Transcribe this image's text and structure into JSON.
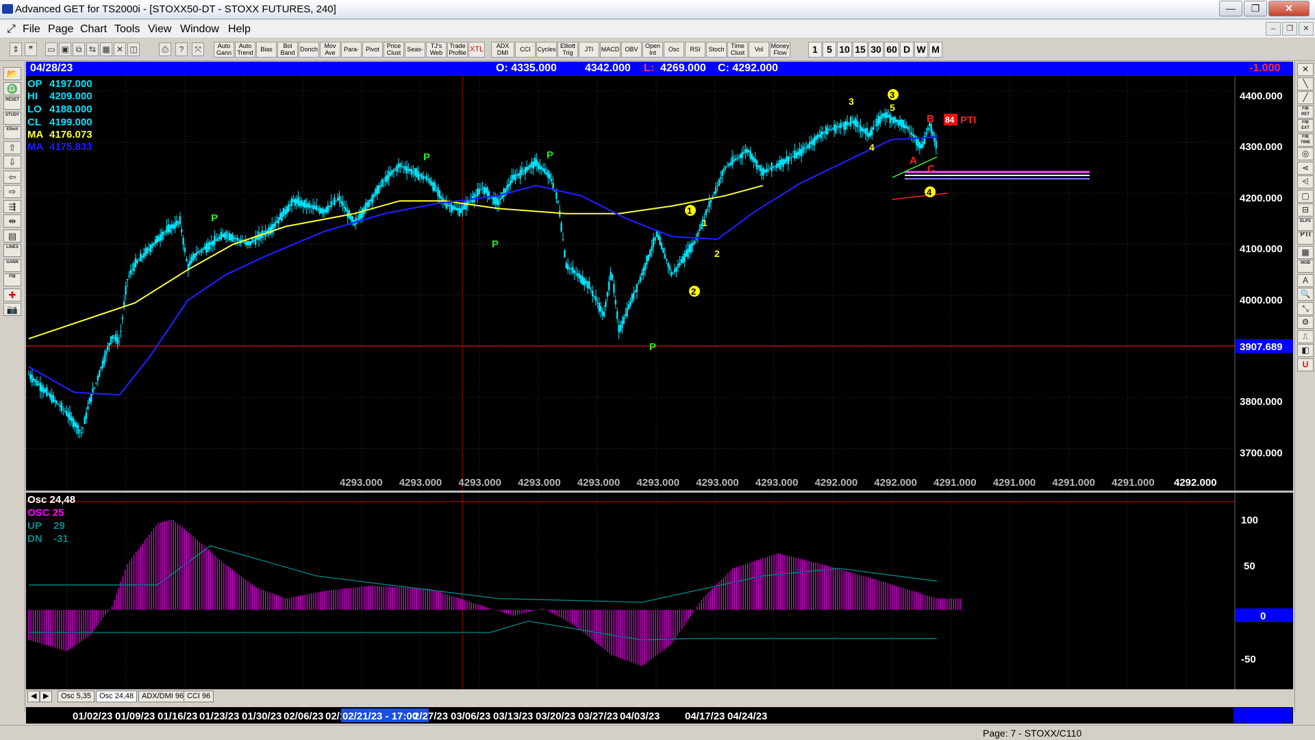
{
  "window": {
    "title": "Advanced GET for TS2000i - [STOXX50-DT - STOXX FUTURES, 240]",
    "minimize": "—",
    "restore": "❐",
    "close": "✕"
  },
  "menu": [
    "File",
    "Page",
    "Chart",
    "Tools",
    "View",
    "Window",
    "Help"
  ],
  "toolbar": {
    "study_buttons": [
      "Auto Gann",
      "Auto Trend",
      "Bias",
      "Bol Band",
      "Donch",
      "Mov Ave",
      "Para-bolic",
      "Pivot",
      "Price Clust",
      "Seas-onals",
      "TJ's Web",
      "Trade Profile",
      "XTL",
      "ADX DMI",
      "CCI",
      "Cycles",
      "Elliott Trig",
      "JTI",
      "MACD",
      "OBV",
      "Open Int",
      "Osc",
      "RSI",
      "Stoch",
      "Time Clust",
      "Vol",
      "Money Flow"
    ],
    "interval_buttons": [
      "1",
      "5",
      "10",
      "15",
      "30",
      "60",
      "D",
      "W",
      "M"
    ]
  },
  "datebar": {
    "date": "04/28/23",
    "open": "O: 4335.000",
    "high": "4342.000",
    "low_label": "L:",
    "low_value": "4269.000",
    "close": "C: 4292.000",
    "change": "-1.000"
  },
  "legend": {
    "op": {
      "label": "OP",
      "value": "4197.000"
    },
    "hi": {
      "label": "HI",
      "value": "4209.000"
    },
    "lo": {
      "label": "LO",
      "value": "4188.000"
    },
    "cl": {
      "label": "CL",
      "value": "4199.000"
    },
    "ma1": {
      "label": "MA",
      "value": "4176.073"
    },
    "ma2": {
      "label": "MA",
      "value": "4175.833"
    }
  },
  "osc_legend": {
    "title": "Osc 24,48",
    "osc": "OSC 25",
    "up": {
      "label": "UP",
      "value": "29"
    },
    "dn": {
      "label": "DN",
      "value": "-31"
    }
  },
  "price_axis": [
    "4400.000",
    "4300.000",
    "4200.000",
    "4100.000",
    "4000.000",
    "3800.000",
    "3700.000"
  ],
  "price_marker": "3907.689",
  "osc_axis": [
    "100",
    "50",
    "0",
    "-50"
  ],
  "bottom_values": [
    "4293.000",
    "4293.000",
    "4293.000",
    "4293.000",
    "4293.000",
    "4293.000",
    "4293.000",
    "4293.000",
    "4292.000",
    "4292.000",
    "4291.000",
    "4291.000",
    "4291.000",
    "4291.000",
    "4292.000"
  ],
  "annotations": {
    "p": "P",
    "one": "1",
    "two": "2",
    "three": "3",
    "four": "4",
    "five": "5",
    "a": "A",
    "b": "B",
    "c": "C",
    "pti_num": "84",
    "pti": "PTI"
  },
  "tabs": [
    "Osc 5,35",
    "Osc 24,48",
    "ADX/DMI 96",
    "CCI 96"
  ],
  "x_axis": [
    "01/02/23",
    "01/09/23",
    "01/16/23",
    "01/23/23",
    "01/30/23",
    "02/06/23",
    "02/1",
    "02/21/23 - 17:00",
    "2/27/23",
    "03/06/23",
    "03/13/23",
    "03/20/23",
    "03/27/23",
    "04/03/23",
    "04/17/23",
    "04/24/23"
  ],
  "status": "Page: 7 - STOXX/C110",
  "colors": {
    "price_bars": "#00e5ff",
    "ma_fast": "#1e1eff",
    "ma_slow": "#ffff33",
    "oscillator": "#ff00ff",
    "bands": "#008b8b",
    "pivot": "#00ff00",
    "wave": "#ffff00"
  },
  "chart_data": {
    "type": "candlestick",
    "x_range": [
      "12/29/22",
      "04/28/23"
    ],
    "y_range": [
      3620,
      4440
    ],
    "price_anchors": [
      {
        "date": "12/29/22",
        "close": 3845
      },
      {
        "date": "01/03/23",
        "close": 3770
      },
      {
        "date": "01/05/23",
        "close": 3730
      },
      {
        "date": "01/06/23",
        "close": 3790
      },
      {
        "date": "01/09/23",
        "close": 3920
      },
      {
        "date": "01/10/23",
        "close": 3910
      },
      {
        "date": "01/11/23",
        "close": 4030
      },
      {
        "date": "01/12/23",
        "close": 4060
      },
      {
        "date": "01/16/23",
        "close": 4125
      },
      {
        "date": "01/18/23",
        "close": 4145
      },
      {
        "date": "01/19/23",
        "close": 4055
      },
      {
        "date": "01/20/23",
        "close": 4080
      },
      {
        "date": "01/24/23",
        "close": 4120
      },
      {
        "date": "01/27/23",
        "close": 4100
      },
      {
        "date": "01/30/23",
        "close": 4130
      },
      {
        "date": "02/02/23",
        "close": 4185
      },
      {
        "date": "02/06/23",
        "close": 4165
      },
      {
        "date": "02/08/23",
        "close": 4190
      },
      {
        "date": "02/10/23",
        "close": 4140
      },
      {
        "date": "02/14/23",
        "close": 4225
      },
      {
        "date": "02/16/23",
        "close": 4255
      },
      {
        "date": "02/20/23",
        "close": 4225
      },
      {
        "date": "02/22/23",
        "close": 4180
      },
      {
        "date": "02/24/23",
        "close": 4165
      },
      {
        "date": "02/27/23",
        "close": 4210
      },
      {
        "date": "03/01/23",
        "close": 4180
      },
      {
        "date": "03/03/23",
        "close": 4230
      },
      {
        "date": "03/06/23",
        "close": 4260
      },
      {
        "date": "03/08/23",
        "close": 4230
      },
      {
        "date": "03/09/23",
        "close": 4180
      },
      {
        "date": "03/10/23",
        "close": 4060
      },
      {
        "date": "03/13/23",
        "close": 4020
      },
      {
        "date": "03/15/23",
        "close": 3960
      },
      {
        "date": "03/16/23",
        "close": 4050
      },
      {
        "date": "03/17/23",
        "close": 3930
      },
      {
        "date": "03/20/23",
        "close": 4040
      },
      {
        "date": "03/22/23",
        "close": 4120
      },
      {
        "date": "03/24/23",
        "close": 4040
      },
      {
        "date": "03/27/23",
        "close": 4105
      },
      {
        "date": "03/29/23",
        "close": 4180
      },
      {
        "date": "03/31/23",
        "close": 4250
      },
      {
        "date": "04/03/23",
        "close": 4285
      },
      {
        "date": "04/05/23",
        "close": 4240
      },
      {
        "date": "04/10/23",
        "close": 4280
      },
      {
        "date": "04/13/23",
        "close": 4320
      },
      {
        "date": "04/17/23",
        "close": 4340
      },
      {
        "date": "04/19/23",
        "close": 4315
      },
      {
        "date": "04/21/23",
        "close": 4355
      },
      {
        "date": "04/24/23",
        "close": 4330
      },
      {
        "date": "04/26/23",
        "close": 4290
      },
      {
        "date": "04/27/23",
        "close": 4335
      },
      {
        "date": "04/28/23",
        "close": 4292
      }
    ],
    "ma_fast": [
      {
        "date": "12/29/22",
        "value": 3860
      },
      {
        "date": "01/04/23",
        "value": 3810
      },
      {
        "date": "01/10/23",
        "value": 3805
      },
      {
        "date": "01/14/23",
        "value": 3880
      },
      {
        "date": "01/19/23",
        "value": 3990
      },
      {
        "date": "01/24/23",
        "value": 4040
      },
      {
        "date": "01/29/23",
        "value": 4075
      },
      {
        "date": "02/06/23",
        "value": 4125
      },
      {
        "date": "02/14/23",
        "value": 4160
      },
      {
        "date": "02/21/23",
        "value": 4180
      },
      {
        "date": "03/01/23",
        "value": 4195
      },
      {
        "date": "03/06/23",
        "value": 4215
      },
      {
        "date": "03/12/23",
        "value": 4195
      },
      {
        "date": "03/18/23",
        "value": 4150
      },
      {
        "date": "03/24/23",
        "value": 4115
      },
      {
        "date": "03/30/23",
        "value": 4110
      },
      {
        "date": "04/04/23",
        "value": 4165
      },
      {
        "date": "04/10/23",
        "value": 4220
      },
      {
        "date": "04/17/23",
        "value": 4270
      },
      {
        "date": "04/22/23",
        "value": 4305
      },
      {
        "date": "04/28/23",
        "value": 4310
      }
    ],
    "ma_slow": [
      {
        "date": "12/29/22",
        "value": 3915
      },
      {
        "date": "01/06/23",
        "value": 3955
      },
      {
        "date": "01/12/23",
        "value": 3985
      },
      {
        "date": "01/19/23",
        "value": 4050
      },
      {
        "date": "01/25/23",
        "value": 4100
      },
      {
        "date": "02/01/23",
        "value": 4135
      },
      {
        "date": "02/10/23",
        "value": 4160
      },
      {
        "date": "02/16/23",
        "value": 4185
      },
      {
        "date": "02/22/23",
        "value": 4185
      },
      {
        "date": "03/01/23",
        "value": 4170
      },
      {
        "date": "03/10/23",
        "value": 4160
      },
      {
        "date": "03/17/23",
        "value": 4160
      },
      {
        "date": "03/24/23",
        "value": 4175
      },
      {
        "date": "03/31/23",
        "value": 4195
      },
      {
        "date": "04/05/23",
        "value": 4215
      }
    ],
    "oscillator": [
      {
        "date": "12/29/22",
        "value": -40
      },
      {
        "date": "01/03/23",
        "value": -55
      },
      {
        "date": "01/06/23",
        "value": -35
      },
      {
        "date": "01/09/23",
        "value": 5
      },
      {
        "date": "01/11/23",
        "value": 60
      },
      {
        "date": "01/15/23",
        "value": 115
      },
      {
        "date": "01/17/23",
        "value": 120
      },
      {
        "date": "01/20/23",
        "value": 95
      },
      {
        "date": "01/24/23",
        "value": 60
      },
      {
        "date": "01/28/23",
        "value": 30
      },
      {
        "date": "02/01/23",
        "value": 15
      },
      {
        "date": "02/06/23",
        "value": 25
      },
      {
        "date": "02/12/23",
        "value": 32
      },
      {
        "date": "02/20/23",
        "value": 28
      },
      {
        "date": "02/27/23",
        "value": 5
      },
      {
        "date": "03/03/23",
        "value": -8
      },
      {
        "date": "03/07/23",
        "value": 2
      },
      {
        "date": "03/11/23",
        "value": -20
      },
      {
        "date": "03/16/23",
        "value": -60
      },
      {
        "date": "03/20/23",
        "value": -75
      },
      {
        "date": "03/24/23",
        "value": -45
      },
      {
        "date": "03/28/23",
        "value": 15
      },
      {
        "date": "04/01/23",
        "value": 55
      },
      {
        "date": "04/07/23",
        "value": 75
      },
      {
        "date": "04/13/23",
        "value": 60
      },
      {
        "date": "04/20/23",
        "value": 40
      },
      {
        "date": "04/28/23",
        "value": 15
      }
    ],
    "band_up": [
      {
        "date": "12/29/22",
        "value": 33
      },
      {
        "date": "01/15/23",
        "value": 33
      },
      {
        "date": "01/22/23",
        "value": 85
      },
      {
        "date": "02/05/23",
        "value": 45
      },
      {
        "date": "03/01/23",
        "value": 15
      },
      {
        "date": "03/20/23",
        "value": 10
      },
      {
        "date": "04/05/23",
        "value": 45
      },
      {
        "date": "04/15/23",
        "value": 55
      },
      {
        "date": "04/28/23",
        "value": 38
      }
    ],
    "band_dn": [
      {
        "date": "12/29/22",
        "value": -30
      },
      {
        "date": "02/28/23",
        "value": -30
      },
      {
        "date": "03/05/23",
        "value": -15
      },
      {
        "date": "03/20/23",
        "value": -40
      },
      {
        "date": "03/27/23",
        "value": -38
      },
      {
        "date": "04/28/23",
        "value": -38
      }
    ],
    "horizontal_line": 3907.689,
    "cursor_date": "02/21/23 - 17:00"
  }
}
